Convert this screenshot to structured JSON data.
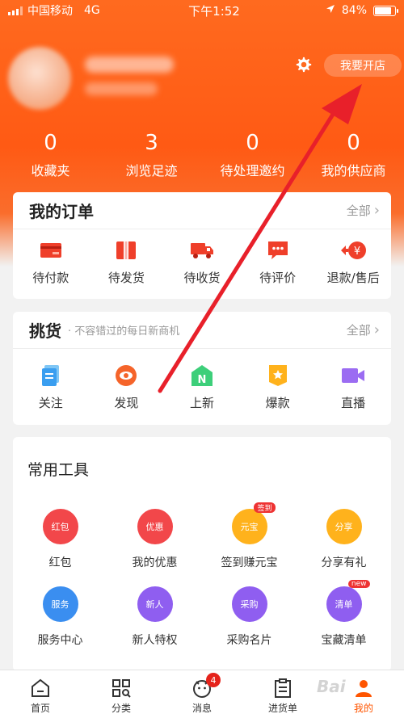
{
  "status_bar": {
    "carrier": "中国移动",
    "network": "4G",
    "time": "下午1:52",
    "battery": "84%",
    "battery_level": 0.84
  },
  "header": {
    "open_shop_label": "我要开店"
  },
  "stats": [
    {
      "value": "0",
      "label": "收藏夹"
    },
    {
      "value": "3",
      "label": "浏览足迹"
    },
    {
      "value": "0",
      "label": "待处理邀约"
    },
    {
      "value": "0",
      "label": "我的供应商"
    }
  ],
  "orders": {
    "title": "我的订单",
    "more_label": "全部",
    "items": [
      {
        "label": "待付款",
        "icon": "wallet-icon"
      },
      {
        "label": "待发货",
        "icon": "package-icon"
      },
      {
        "label": "待收货",
        "icon": "truck-icon"
      },
      {
        "label": "待评价",
        "icon": "comment-icon"
      },
      {
        "label": "退款/售后",
        "icon": "refund-icon"
      }
    ]
  },
  "pick": {
    "title": "挑货",
    "subtitle": "· 不容错过的每日新商机",
    "more_label": "全部",
    "items": [
      {
        "label": "关注",
        "icon": "document-icon"
      },
      {
        "label": "发现",
        "icon": "eye-icon"
      },
      {
        "label": "上新",
        "icon": "new-icon"
      },
      {
        "label": "爆款",
        "icon": "star-badge-icon"
      },
      {
        "label": "直播",
        "icon": "video-camera-icon"
      }
    ]
  },
  "tools": {
    "title": "常用工具",
    "items": [
      {
        "label": "红包",
        "circle_text": "红包",
        "color": "#f2474a"
      },
      {
        "label": "我的优惠",
        "circle_text": "优惠",
        "color": "#f2474a"
      },
      {
        "label": "签到赚元宝",
        "circle_text": "元宝",
        "tag": "签到",
        "color": "#ffb21c"
      },
      {
        "label": "分享有礼",
        "circle_text": "分享",
        "color": "#ffb21c"
      },
      {
        "label": "服务中心",
        "circle_text": "服务",
        "color": "#3a8ef0"
      },
      {
        "label": "新人特权",
        "circle_text": "新人",
        "color": "#8f5ef0"
      },
      {
        "label": "采购名片",
        "circle_text": "采购",
        "color": "#8f5ef0"
      },
      {
        "label": "宝藏清单",
        "circle_text": "清单",
        "tag": "new",
        "color": "#8f5ef0"
      }
    ]
  },
  "tab_bar": {
    "items": [
      {
        "label": "首页"
      },
      {
        "label": "分类"
      },
      {
        "label": "消息",
        "badge": "4"
      },
      {
        "label": "进货单"
      },
      {
        "label": "我的"
      }
    ]
  },
  "watermark": "Bai",
  "colors": {
    "accent": "#ff5500",
    "header_bg": "#ff6a1f",
    "annotation_arrow": "#e8202a"
  }
}
